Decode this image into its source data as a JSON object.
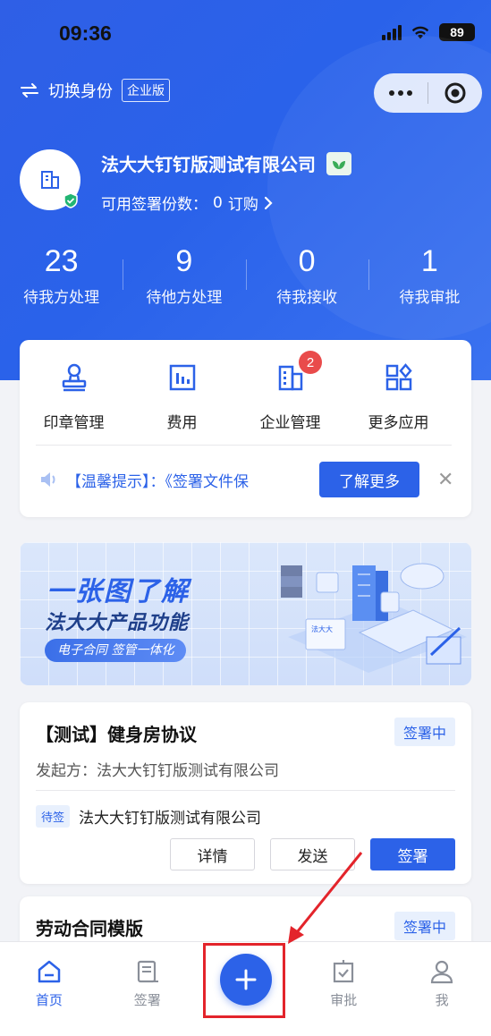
{
  "status_bar": {
    "time": "09:36",
    "battery": "89"
  },
  "header": {
    "switch_label": "切换身份",
    "edition_tag": "企业版"
  },
  "company": {
    "name": "法大大钉钉版测试有限公司",
    "quota_label": "可用签署份数：",
    "quota_value": "0",
    "order_link": "订购"
  },
  "stats": [
    {
      "value": "23",
      "label": "待我方处理"
    },
    {
      "value": "9",
      "label": "待他方处理"
    },
    {
      "value": "0",
      "label": "待我接收"
    },
    {
      "value": "1",
      "label": "待我审批"
    }
  ],
  "apps": [
    {
      "label": "印章管理",
      "icon": "stamp-icon"
    },
    {
      "label": "费用",
      "icon": "bill-icon"
    },
    {
      "label": "企业管理",
      "icon": "building-icon",
      "badge": "2"
    },
    {
      "label": "更多应用",
      "icon": "grid-apps-icon"
    }
  ],
  "notice": {
    "text": "【温馨提示】：《签署文件保",
    "button": "了解更多"
  },
  "banner": {
    "line1": "一张图了解",
    "line2": "法大大产品功能",
    "pill": "电子合同 签管一体化",
    "device_logo": "法大大"
  },
  "documents": [
    {
      "title": "【测试】健身房协议",
      "status": "签署中",
      "initiator_label": "发起方：",
      "initiator": "法大大钉钉版测试有限公司",
      "pending_tag": "待签",
      "pending_party": "法大大钉钉版测试有限公司",
      "actions": [
        "详情",
        "发送",
        "签署"
      ]
    },
    {
      "title": "劳动合同模版",
      "status": "签署中"
    }
  ],
  "tabbar": [
    {
      "label": "首页",
      "icon": "home-icon",
      "active": true
    },
    {
      "label": "签署",
      "icon": "document-sign-icon"
    },
    {
      "label": "",
      "icon": "plus-icon"
    },
    {
      "label": "审批",
      "icon": "approval-icon"
    },
    {
      "label": "我",
      "icon": "user-icon"
    }
  ],
  "colors": {
    "primary": "#2c62e8",
    "badge": "#e94b4b",
    "highlight": "#e3242b"
  }
}
